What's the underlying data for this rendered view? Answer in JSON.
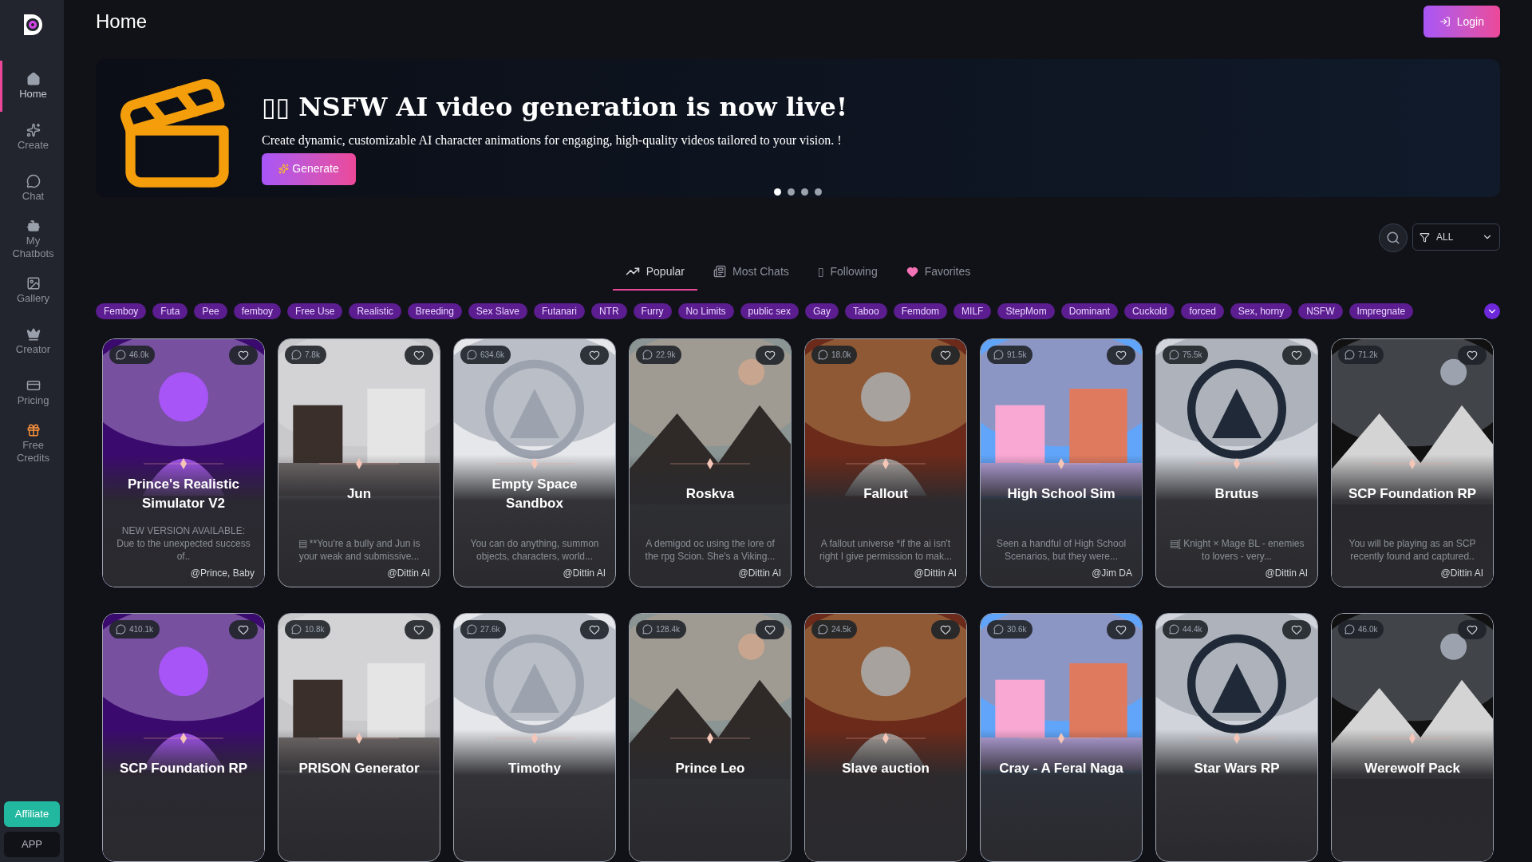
{
  "sidebar": {
    "items": [
      {
        "label": "Home",
        "selected": true
      },
      {
        "label": "Create",
        "selected": false
      },
      {
        "label": "Chat",
        "selected": false
      },
      {
        "label": "My Chatbots",
        "selected": false
      },
      {
        "label": "Gallery",
        "selected": false
      },
      {
        "label": "Creator",
        "selected": false
      },
      {
        "label": "Pricing",
        "selected": false
      },
      {
        "label": "Free Credits",
        "selected": false
      }
    ],
    "buttons": [
      {
        "label": "Affiliate",
        "kind": "accent"
      },
      {
        "label": "APP",
        "kind": "dark"
      }
    ]
  },
  "header": {
    "title": "Home",
    "login": "Login"
  },
  "banner": {
    "title": "▯▯ NSFW AI video generation is now live!",
    "text": "Create dynamic, customizable AI character animations for engaging, high-quality videos tailored to your vision. !",
    "button": "Generate",
    "dots": [
      {
        "selected": true
      },
      {
        "selected": false
      },
      {
        "selected": false
      },
      {
        "selected": false
      }
    ]
  },
  "filter": {
    "value": "ALL"
  },
  "tabs": [
    {
      "label": "Popular",
      "kind": "trend",
      "selected": true
    },
    {
      "label": "Most Chats",
      "kind": "list",
      "selected": false
    },
    {
      "label": "Following",
      "kind": "glyph",
      "glyph": "▯",
      "selected": false
    },
    {
      "label": "Favorites",
      "kind": "heart",
      "selected": false
    }
  ],
  "tags": [
    "Femboy",
    "Futa",
    "Pee",
    "femboy",
    "Free Use",
    "Realistic",
    "Breeding",
    "Sex Slave",
    "Futanari",
    "NTR",
    "Furry",
    "No Limits",
    "public sex",
    "Gay",
    "Taboo",
    "Femdom",
    "MILF",
    "StepMom",
    "Dominant",
    "Cuckold",
    "forced",
    "Sex, horny",
    "NSFW",
    "Impregnate"
  ],
  "cards": [
    {
      "count": "46.0k",
      "title": "Prince's Realistic Simulator V2",
      "description": "NEW VERSION AVAILABLE: Due to the unexpected success of..",
      "author": "@Prince, Baby"
    },
    {
      "count": "7.8k",
      "title": "Jun",
      "description": "▤ **You're a bully and Jun is your weak and submissive...",
      "author": "@Dittin AI"
    },
    {
      "count": "634.6k",
      "title": "Empty Space Sandbox",
      "description": "You can do anything, summon objects, characters, world...",
      "author": "@Dittin AI"
    },
    {
      "count": "22.9k",
      "title": "Roskva",
      "description": "A demigod oc using the lore of the rpg Scion. She's a Viking...",
      "author": "@Dittin AI"
    },
    {
      "count": "18.0k",
      "title": "Fallout",
      "description": "A fallout universe *if the ai isn't right I give permission to mak...",
      "author": "@Dittin AI"
    },
    {
      "count": "91.5k",
      "title": "High School Sim",
      "description": "Seen a handful of High School Scenarios, but they were...",
      "author": "@Jim DA"
    },
    {
      "count": "75.5k",
      "title": "Brutus",
      "description": "▤[ Knight × Mage BL - enemies to lovers - very...",
      "author": "@Dittin AI"
    },
    {
      "count": "71.2k",
      "title": "SCP Foundation RP",
      "description": "You will be playing as an SCP recently found and captured..",
      "author": "@Dittin AI"
    },
    {
      "count": "410.1k",
      "title": "SCP Foundation RP"
    },
    {
      "count": "10.8k",
      "title": "PRISON Generator"
    },
    {
      "count": "27.6k",
      "title": "Timothy"
    },
    {
      "count": "128.4k",
      "title": "Prince Leo"
    },
    {
      "count": "24.5k",
      "title": "Slave auction"
    },
    {
      "count": "30.6k",
      "title": "Cray - A Feral Naga"
    },
    {
      "count": "44.4k",
      "title": "Star Wars RP"
    },
    {
      "count": "46.0k",
      "title": "Werewolf Pack"
    }
  ]
}
